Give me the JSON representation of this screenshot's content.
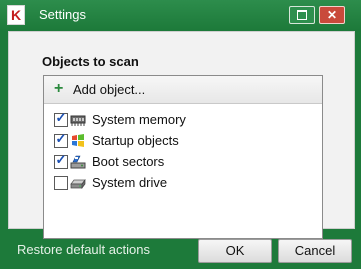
{
  "window": {
    "title": "Settings",
    "logo_text": "K",
    "minimize_glyph": "",
    "close_glyph": "✕"
  },
  "panel": {
    "section_title": "Objects to scan",
    "add_label": "Add object...",
    "items": [
      {
        "label": "System memory",
        "checked": true,
        "icon": "memory-chip-icon"
      },
      {
        "label": "Startup objects",
        "checked": true,
        "icon": "windows-flag-icon"
      },
      {
        "label": "Boot sectors",
        "checked": true,
        "icon": "boot-sector-icon"
      },
      {
        "label": "System drive",
        "checked": false,
        "icon": "hard-drive-icon"
      }
    ]
  },
  "footer": {
    "restore_link": "Restore default actions",
    "ok_label": "OK",
    "cancel_label": "Cancel"
  },
  "colors": {
    "accent": "#1d7a3a",
    "checkbox_tick": "#1a4fb3",
    "close_button": "#c94a3b"
  }
}
